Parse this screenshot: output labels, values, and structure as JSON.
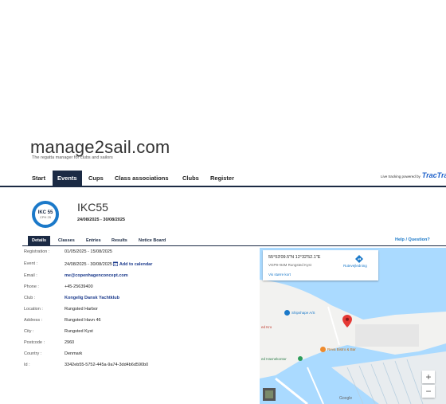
{
  "site": {
    "title": "manage2sail.com",
    "tagline": "The regatta manager for clubs and sailors"
  },
  "nav": {
    "items": [
      {
        "label": "Start"
      },
      {
        "label": "Events"
      },
      {
        "label": "Cups"
      },
      {
        "label": "Class associations"
      },
      {
        "label": "Clubs"
      },
      {
        "label": "Register"
      }
    ],
    "active": "Events",
    "tracking_text": "Live tracking powered by",
    "tracking_brand": "TracTrac"
  },
  "event": {
    "badge_main": "IKC 55",
    "badge_sub": "CPH 25",
    "title": "IKC55",
    "dates": "24/08/2025 - 30/08/2025"
  },
  "subtabs": {
    "items": [
      {
        "label": "Details"
      },
      {
        "label": "Classes"
      },
      {
        "label": "Entries"
      },
      {
        "label": "Results"
      },
      {
        "label": "Notice Board"
      }
    ],
    "active": "Details",
    "help": "Help / Question?"
  },
  "details": [
    {
      "label": "Registration :",
      "value": "01/05/2025 - 15/08/2025"
    },
    {
      "label": "Event :",
      "value": "24/08/2025 - 30/08/2025",
      "extra": "Add to calendar"
    },
    {
      "label": "Email :",
      "value": "me@copenhagenconcept.com"
    },
    {
      "label": "Phone :",
      "value": "+45-25639400"
    },
    {
      "label": "Club :",
      "value": "Kongelig Dansk Yachtklub"
    },
    {
      "label": "Location :",
      "value": "Rungsted Harbor"
    },
    {
      "label": "Address :",
      "value": "Rungsted Havn 46"
    },
    {
      "label": "City :",
      "value": "Rungsted Kyst"
    },
    {
      "label": "Postcode :",
      "value": "2960"
    },
    {
      "label": "Country :",
      "value": "Denmark"
    },
    {
      "label": "Id :",
      "value": "3342eb55-5752-445a-9a74-3dd4b6d590b0"
    }
  ],
  "map": {
    "coords": "55°53'09.5\"N 12°32'52.1\"E",
    "plus_code": "VGP9+94M Rungsted Kyst",
    "larger_map": "Vis større kort",
    "directions": "Rutevejledning",
    "places": [
      "Shipshape A/S",
      "Reva Bistro & Bar",
      "ed Havnekontor",
      "ed Kro"
    ],
    "zoom_in": "+",
    "zoom_out": "−",
    "attribution": "Google",
    "colors": {
      "water": "#aadaff",
      "land": "#f2f2f0",
      "pin": "#e53935"
    }
  },
  "colors": {
    "navy": "#1b2a44",
    "accent": "#1b79c9"
  }
}
